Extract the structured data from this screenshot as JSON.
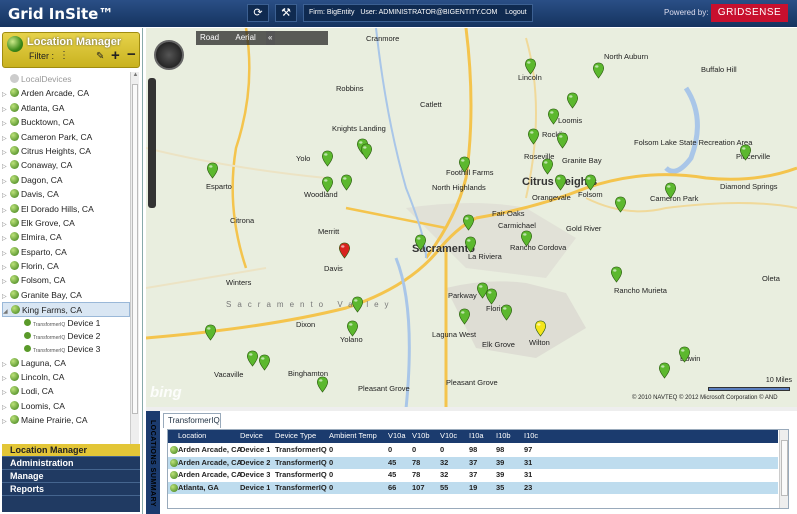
{
  "app_title": "Grid InSite™",
  "topbar": {
    "refresh_icon": "refresh-icon",
    "tools_icon": "wrench-icon",
    "firm_label": "Firm: BigEntity",
    "user_label": "User: ADMINISTRATOR@BIGENTITY.COM",
    "logout_label": "Logout",
    "powered_by": "Powered by:",
    "brand": "GRIDSENSE",
    "brand_color": "#c8102e"
  },
  "location_manager": {
    "title": "Location Manager",
    "filter_label": "Filter :",
    "nodes": [
      {
        "label": "LocalDevices",
        "kind": "local"
      },
      {
        "label": "Arden Arcade, CA"
      },
      {
        "label": "Atlanta, GA"
      },
      {
        "label": "Bucktown, CA"
      },
      {
        "label": "Cameron Park, CA"
      },
      {
        "label": "Citrus Heights, CA"
      },
      {
        "label": "Conaway, CA"
      },
      {
        "label": "Dagon, CA"
      },
      {
        "label": "Davis, CA"
      },
      {
        "label": "El Dorado Hills, CA"
      },
      {
        "label": "Elk Grove, CA"
      },
      {
        "label": "Elmira, CA"
      },
      {
        "label": "Esparto, CA"
      },
      {
        "label": "Florin, CA"
      },
      {
        "label": "Folsom, CA"
      },
      {
        "label": "Granite Bay, CA"
      },
      {
        "label": "King Farms, CA",
        "selected": true
      },
      {
        "label": "Laguna, CA"
      },
      {
        "label": "Lincoln, CA"
      },
      {
        "label": "Lodi, CA"
      },
      {
        "label": "Loomis, CA"
      },
      {
        "label": "Maine Prairie, CA"
      }
    ],
    "children": [
      {
        "type_label": "TransformerIQ",
        "label": "Device 1"
      },
      {
        "type_label": "TransformerIQ",
        "label": "Device 2"
      },
      {
        "type_label": "TransformerIQ",
        "label": "Device 3"
      }
    ]
  },
  "nav_menu": [
    "Location Manager",
    "Administration",
    "Manage",
    "Reports"
  ],
  "map": {
    "road_label": "Road",
    "aerial_label": "Aerial",
    "bing_label": "bing",
    "scale_label": "10 Miles",
    "copyright": "© 2010 NAVTEQ  © 2012 Microsoft Corporation  © AND",
    "pin_green": "#5cb82e",
    "pin_red": "#d8231f",
    "pin_yellow": "#f4e51a",
    "cities": [
      {
        "name": "Cranmore"
      },
      {
        "name": "North Auburn"
      },
      {
        "name": "Buffalo Hill"
      },
      {
        "name": "Robbins"
      },
      {
        "name": "Lincoln"
      },
      {
        "name": "Catlett"
      },
      {
        "name": "Knights Landing"
      },
      {
        "name": "Rocklin"
      },
      {
        "name": "Loomis"
      },
      {
        "name": "Yolo"
      },
      {
        "name": "Roseville"
      },
      {
        "name": "Granite Bay"
      },
      {
        "name": "Folsom Lake State Recreation Area"
      },
      {
        "name": "Placerville"
      },
      {
        "name": "Esparto"
      },
      {
        "name": "Woodland"
      },
      {
        "name": "North Highlands"
      },
      {
        "name": "Foothill Farms"
      },
      {
        "name": "Citrus Heights",
        "big": true
      },
      {
        "name": "Orangevale"
      },
      {
        "name": "Folsom"
      },
      {
        "name": "Cameron Park"
      },
      {
        "name": "Diamond Springs"
      },
      {
        "name": "Fair Oaks"
      },
      {
        "name": "Carmichael"
      },
      {
        "name": "Citrona"
      },
      {
        "name": "Merritt"
      },
      {
        "name": "Gold River"
      },
      {
        "name": "Sacramento",
        "big": true
      },
      {
        "name": "Davis"
      },
      {
        "name": "La Riviera"
      },
      {
        "name": "Rancho Cordova"
      },
      {
        "name": "Winters"
      },
      {
        "name": "Parkway"
      },
      {
        "name": "Florin"
      },
      {
        "name": "Rancho Murieta"
      },
      {
        "name": "Dixon"
      },
      {
        "name": "Laguna West"
      },
      {
        "name": "Yolano"
      },
      {
        "name": "Elk Grove"
      },
      {
        "name": "Wilton"
      },
      {
        "name": "Vacaville"
      },
      {
        "name": "Binghamton"
      },
      {
        "name": "Pleasant Grove"
      },
      {
        "name": "Pleasant Grove"
      },
      {
        "name": "Edwin"
      },
      {
        "name": "Oleta"
      },
      {
        "name": "Sacramento Valley",
        "spaced": true
      }
    ]
  },
  "bottom": {
    "vertical_title": "LOCATIONS SUMMARY",
    "tab_label": "TransformerIQ",
    "columns": [
      "Location",
      "Device",
      "Device Type",
      "Ambient Temp",
      "V10a",
      "V10b",
      "V10c",
      "I10a",
      "I10b",
      "I10c"
    ],
    "rows": [
      [
        "Arden Arcade, CA",
        "Device 1",
        "TransformerIQ",
        "0",
        "0",
        "0",
        "0",
        "98",
        "98",
        "97"
      ],
      [
        "Arden Arcade, CA",
        "Device 2",
        "TransformerIQ",
        "0",
        "45",
        "78",
        "32",
        "37",
        "39",
        "31"
      ],
      [
        "Arden Arcade, CA",
        "Device 3",
        "TransformerIQ",
        "0",
        "45",
        "78",
        "32",
        "37",
        "39",
        "31"
      ],
      [
        "Atlanta, GA",
        "Device 1",
        "TransformerIQ",
        "0",
        "66",
        "107",
        "55",
        "19",
        "35",
        "23"
      ]
    ]
  }
}
